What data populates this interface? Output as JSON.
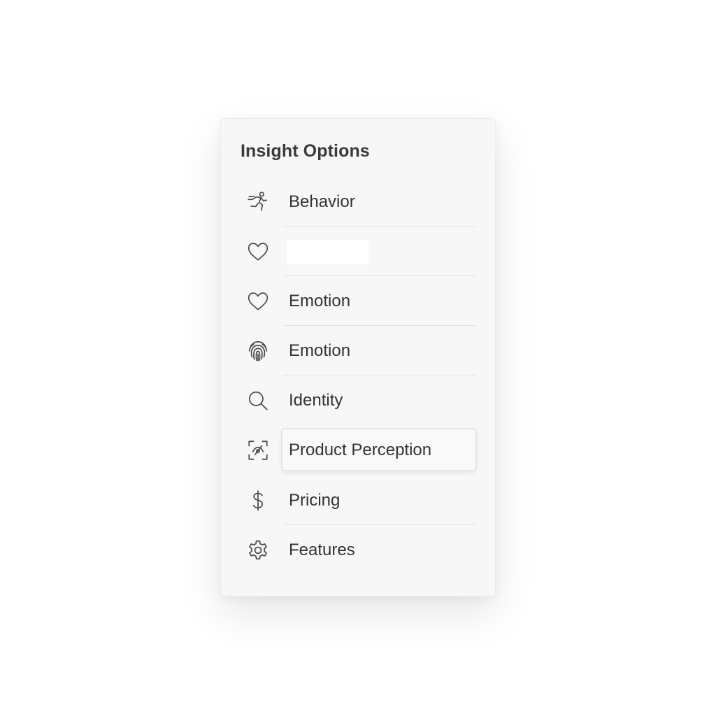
{
  "panel": {
    "title": "Insight Options",
    "items": [
      {
        "label": "Behavior",
        "icon": "running-person-icon"
      },
      {
        "label": "",
        "icon": "heart-icon"
      },
      {
        "label": "Emotion",
        "icon": "heart-icon"
      },
      {
        "label": "Emotion",
        "icon": "fingerprint-icon"
      },
      {
        "label": "Identity",
        "icon": "search-icon"
      },
      {
        "label": "Product Perception",
        "icon": "scan-eye-icon"
      },
      {
        "label": "Pricing",
        "icon": "dollar-icon"
      },
      {
        "label": "Features",
        "icon": "gear-icon"
      }
    ]
  }
}
